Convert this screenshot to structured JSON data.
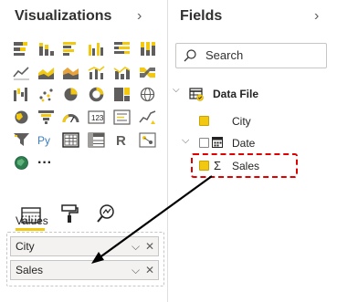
{
  "visualizations": {
    "title": "Visualizations",
    "collapse_glyph": "›",
    "icons": [
      "stacked-bar-chart-icon",
      "stacked-column-chart-icon",
      "clustered-bar-chart-icon",
      "clustered-column-chart-icon",
      "100pct-stacked-bar-icon",
      "100pct-stacked-column-icon",
      "line-chart-icon",
      "area-chart-icon",
      "stacked-area-chart-icon",
      "line-clustered-column-icon",
      "line-stacked-column-icon",
      "ribbon-chart-icon",
      "waterfall-chart-icon",
      "scatter-chart-icon",
      "pie-chart-icon",
      "donut-chart-icon",
      "treemap-icon",
      "map-icon",
      "filled-map-icon",
      "funnel-icon",
      "gauge-icon",
      "card-icon",
      "multi-row-card-icon",
      "kpi-icon",
      "slicer-icon",
      "python-visual-icon",
      "table-icon",
      "matrix-icon",
      "r-script-visual-icon",
      "key-influencers-icon",
      "arcgis-map-icon",
      "more-visuals-icon"
    ],
    "python_label": "Py",
    "r_label": "R",
    "more_label": "···",
    "tabs": [
      "fields-tab-icon",
      "format-paint-roller-icon",
      "analytics-magnifier-icon"
    ],
    "values_label": "Values",
    "wells": [
      {
        "label": "City",
        "chevron": "⌵",
        "remove": "✕"
      },
      {
        "label": "Sales",
        "chevron": "⌵",
        "remove": "✕"
      }
    ]
  },
  "fields": {
    "title": "Fields",
    "collapse_glyph": "›",
    "search_placeholder": "Search",
    "table_name": "Data File",
    "items": [
      {
        "label": "City",
        "checked": true
      },
      {
        "label": "Date",
        "checked": false
      },
      {
        "label": "Sales",
        "checked": true
      }
    ],
    "sigma": "Σ"
  },
  "colors": {
    "accent_yellow": "#F2C811",
    "highlight_red": "#E00000",
    "arrow": "#000000"
  }
}
